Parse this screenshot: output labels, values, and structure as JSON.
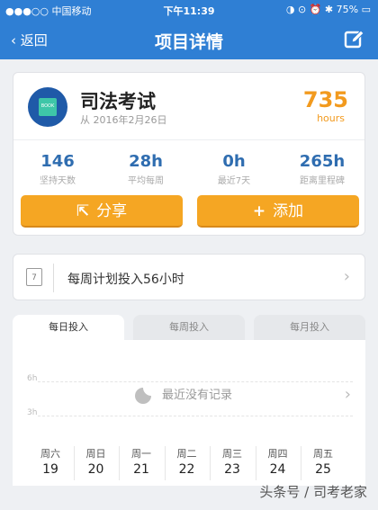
{
  "status": {
    "carrier": "●●●○○ 中国移动",
    "time": "下午11:39",
    "battery": "75%",
    "icons": "◑ ⊙ ⏰ ✱"
  },
  "nav": {
    "back_label": "返回",
    "title": "项目详情",
    "edit_icon": "edit-icon"
  },
  "project": {
    "name": "司法考试",
    "since": "从 2016年2月26日",
    "hours": "735",
    "hours_unit": "hours",
    "icon_label": "BOOK",
    "stats": [
      {
        "value": "146",
        "label": "坚持天数"
      },
      {
        "value": "28h",
        "label": "平均每周"
      },
      {
        "value": "0h",
        "label": "最近7天"
      },
      {
        "value": "265h",
        "label": "距离里程碑"
      }
    ],
    "share_label": "分享",
    "add_label": "添加"
  },
  "plan": {
    "calendar_day": "7",
    "text": "每周计划投入56小时"
  },
  "tabs": [
    {
      "label": "每日投入",
      "active": true
    },
    {
      "label": "每周投入",
      "active": false
    },
    {
      "label": "每月投入",
      "active": false
    }
  ],
  "chart_data": {
    "type": "bar",
    "categories": [
      "周六 19",
      "周日 20",
      "周一 21",
      "周二 22",
      "周三 23",
      "周四 24",
      "周五 25"
    ],
    "values": [],
    "y_ticks": [
      "6h",
      "3h"
    ],
    "empty_message": "最近没有记录",
    "weekdays": [
      "周六",
      "周日",
      "周一",
      "周二",
      "周三",
      "周四",
      "周五"
    ],
    "dates": [
      "19",
      "20",
      "21",
      "22",
      "23",
      "24",
      "25"
    ]
  },
  "watermark": "头条号 / 司考老家"
}
